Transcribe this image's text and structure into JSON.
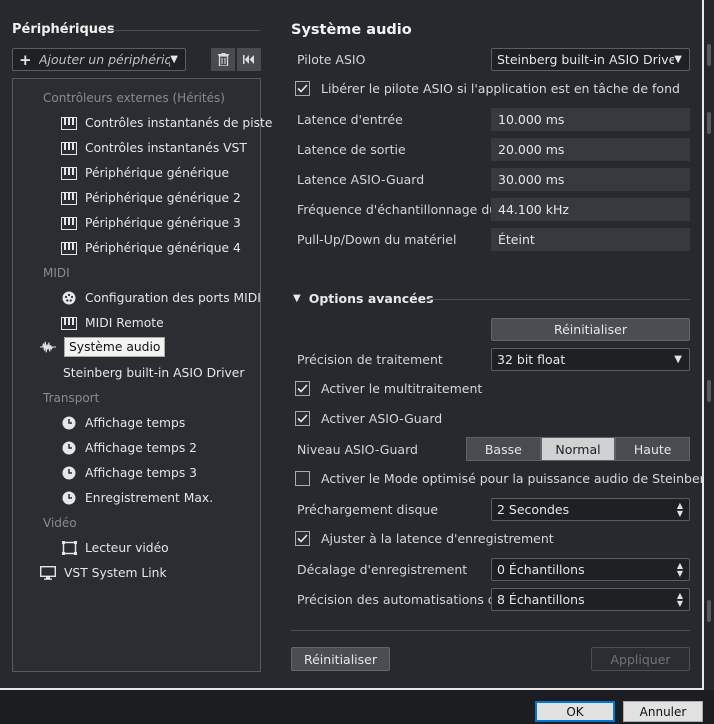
{
  "left": {
    "title": "Périphériques",
    "add_device_placeholder": "Ajouter un périphériq.",
    "categories": {
      "external": "Contrôleurs externes (Hérités)",
      "midi": "MIDI",
      "transport": "Transport",
      "video": "Vidéo"
    },
    "external_items": [
      "Contrôles instantanés de piste",
      "Contrôles instantanés VST",
      "Périphérique générique",
      "Périphérique générique 2",
      "Périphérique générique 3",
      "Périphérique générique 4"
    ],
    "midi_items": [
      "Configuration des ports MIDI",
      "MIDI Remote"
    ],
    "audio_system": "Système audio",
    "audio_driver": "Steinberg built-in ASIO Driver",
    "transport_items": [
      "Affichage temps",
      "Affichage temps 2",
      "Affichage temps 3",
      "Enregistrement Max."
    ],
    "video_items": [
      "Lecteur vidéo"
    ],
    "vst_system_link": "VST System Link"
  },
  "right": {
    "title": "Système audio",
    "asio_driver_label": "Pilote ASIO",
    "asio_driver_value": "Steinberg built-in ASIO Driver",
    "release_driver_label": "Libérer le pilote ASIO si l'application est en tâche de fond",
    "release_driver_checked": true,
    "info_rows": [
      {
        "label": "Latence d'entrée",
        "value": "10.000 ms"
      },
      {
        "label": "Latence de sortie",
        "value": "20.000 ms"
      },
      {
        "label": "Latence ASIO-Guard",
        "value": "30.000 ms"
      },
      {
        "label": "Fréquence d'échantillonnage du matériel",
        "value": "44.100 kHz"
      },
      {
        "label": "Pull-Up/Down du matériel",
        "value": "Éteint"
      }
    ],
    "advanced": {
      "title": "Options avancées",
      "reset_label": "Réinitialiser",
      "precision_label": "Précision de traitement",
      "precision_value": "32 bit float",
      "multiprocessing_label": "Activer le multitraitement",
      "multiprocessing_checked": true,
      "asioguard_label": "Activer ASIO-Guard",
      "asioguard_checked": true,
      "asioguard_level_label": "Niveau ASIO-Guard",
      "asioguard_levels": [
        "Basse",
        "Normal",
        "Haute"
      ],
      "asioguard_level_selected": "Normal",
      "power_mode_label": "Activer le Mode optimisé pour la puissance audio de Steinberg",
      "power_mode_checked": false,
      "disk_preload_label": "Préchargement disque",
      "disk_preload_value": "2 Secondes",
      "adjust_latency_label": "Ajuster à la latence d'enregistrement",
      "adjust_latency_checked": true,
      "record_offset_label": "Décalage d'enregistrement",
      "record_offset_value": "0 Échantillons",
      "automation_precision_label": "Précision des automatisations d.",
      "automation_precision_value": "8 Échantillons"
    },
    "reset_button": "Réinitialiser",
    "apply_button": "Appliquer"
  },
  "dialog": {
    "ok": "OK",
    "cancel": "Annuler"
  },
  "colors": {
    "panel_bg": "#26292d",
    "tree_bg": "#2a2d31",
    "field_bg": "#363a3f",
    "selected_segment": "#cfd1d3",
    "ok_border": "#0078d7"
  }
}
